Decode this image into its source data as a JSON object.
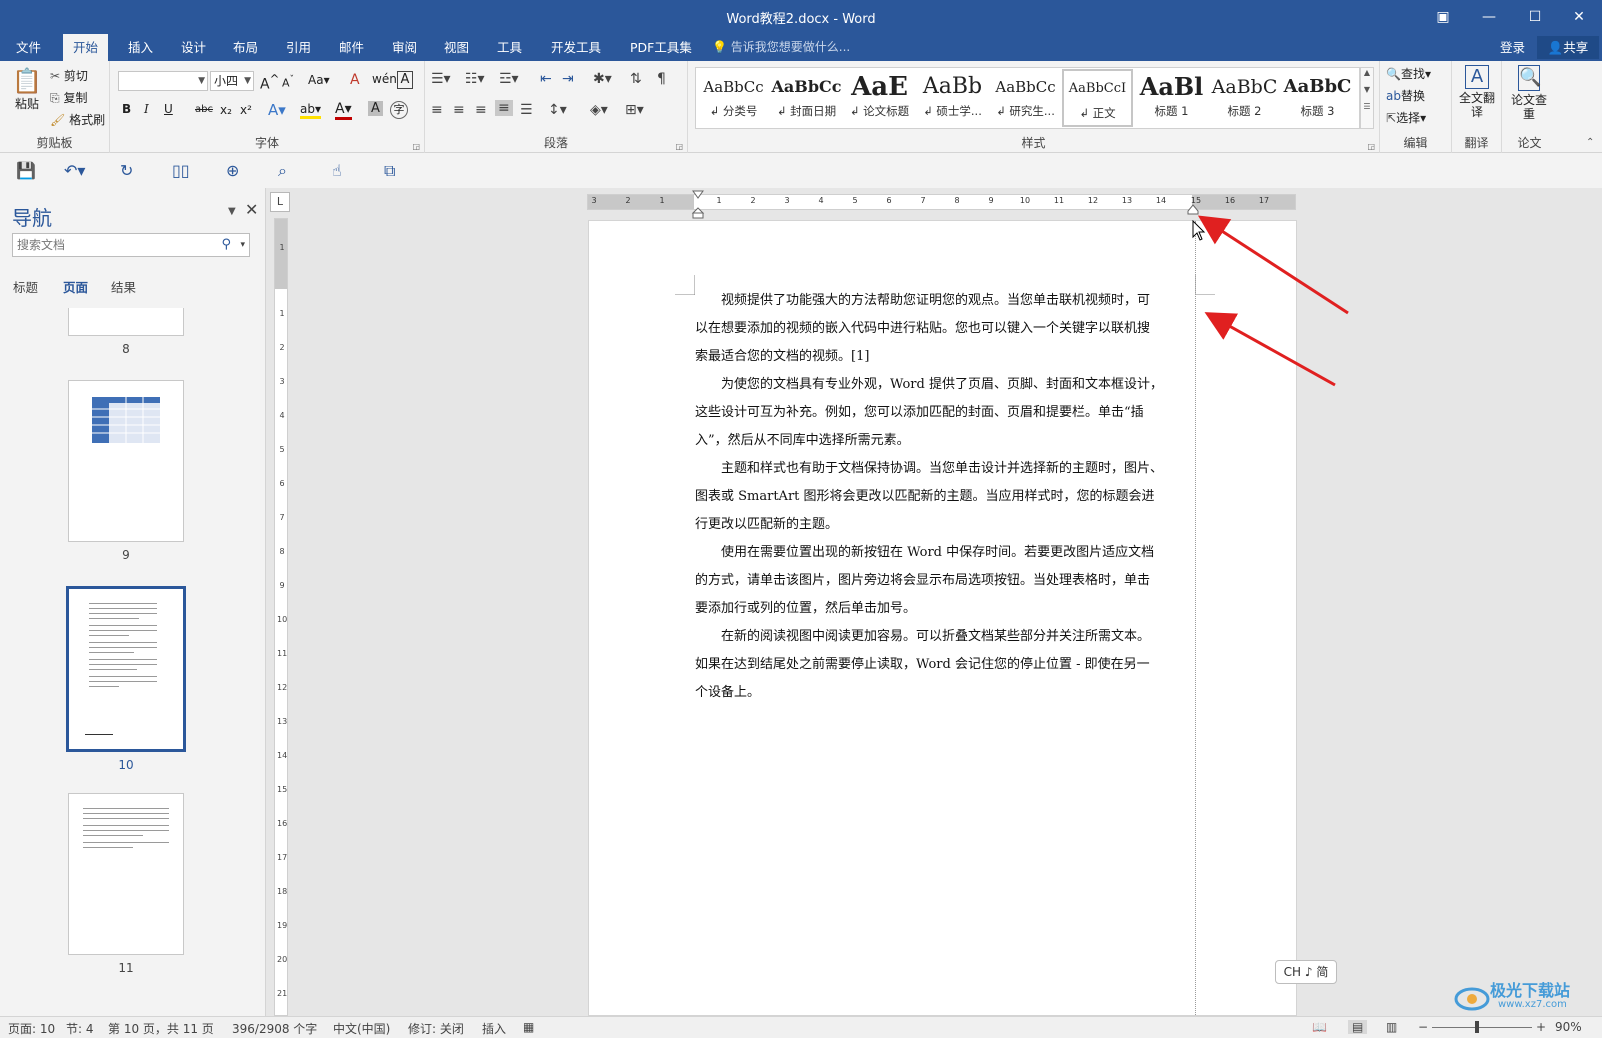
{
  "window": {
    "title": "Word教程2.docx - Word",
    "restore_icon": "ribbon-display-icon",
    "minimize": "—",
    "maximize": "☐",
    "close": "✕"
  },
  "tabs": [
    "文件",
    "开始",
    "插入",
    "设计",
    "布局",
    "引用",
    "邮件",
    "审阅",
    "视图",
    "工具",
    "开发工具",
    "PDF工具集"
  ],
  "active_tab": "开始",
  "tell_me": "告诉我您想要做什么...",
  "account": {
    "login": "登录",
    "share": "共享"
  },
  "ribbon": {
    "clipboard": {
      "label": "剪贴板",
      "paste": "粘贴",
      "cut": "剪切",
      "copy": "复制",
      "format_painter": "格式刷"
    },
    "font": {
      "label": "字体",
      "font_name": "",
      "font_size": "小四",
      "change_case": "Aa",
      "bold": "B",
      "italic": "I",
      "underline": "U",
      "strikethrough": "abc",
      "subscript": "x₂",
      "superscript": "x²",
      "text_effects": "A",
      "highlight": "ab",
      "font_color": "A",
      "char_shading": "A",
      "phonetic": "wén",
      "char_border": "A",
      "grow": "A",
      "shrink": "A",
      "clear": "A",
      "enclose": "字"
    },
    "paragraph": {
      "label": "段落"
    },
    "styles": {
      "label": "样式",
      "items": [
        {
          "preview": "AaBbCc",
          "name": "↲ 分类号"
        },
        {
          "preview": "AaBbCc",
          "name": "↲ 封面日期"
        },
        {
          "preview": "AaE",
          "name": "↲ 论文标题"
        },
        {
          "preview": "AaBb",
          "name": "↲ 硕士学..."
        },
        {
          "preview": "AaBbCc",
          "name": "↲ 研究生..."
        },
        {
          "preview": "AaBbCcI",
          "name": "↲ 正文"
        },
        {
          "preview": "AaBl",
          "name": "标题 1"
        },
        {
          "preview": "AaBbC",
          "name": "标题 2"
        },
        {
          "preview": "AaBbC",
          "name": "标题 3"
        }
      ],
      "selected_index": 5
    },
    "editing": {
      "label": "编辑",
      "find": "查找",
      "replace": "替换",
      "select": "选择"
    },
    "translate": {
      "label": "翻译",
      "full_translate": "全文翻译"
    },
    "paper": {
      "label": "论文",
      "check": "论文查重"
    }
  },
  "nav": {
    "title": "导航",
    "search_placeholder": "搜索文档",
    "tabs": [
      "标题",
      "页面",
      "结果"
    ],
    "active_tab": "页面",
    "pages": [
      "8",
      "9",
      "10",
      "11"
    ],
    "selected_page": "10"
  },
  "ruler": {
    "h_ticks": [
      "3",
      "2",
      "1",
      "1",
      "2",
      "3",
      "4",
      "5",
      "6",
      "7",
      "8",
      "9",
      "10",
      "11",
      "12",
      "13",
      "14",
      "15",
      "16",
      "17"
    ],
    "v_ticks": [
      "1",
      "1",
      "2",
      "3",
      "4",
      "5",
      "6",
      "7",
      "8",
      "9",
      "10",
      "11",
      "12",
      "13",
      "14",
      "15",
      "16",
      "17",
      "18",
      "19",
      "20",
      "21"
    ],
    "tab_selector": "L"
  },
  "document": {
    "paragraphs": [
      [
        "　　视频提供了功能强大的方法帮助您证明您的观点。当您单击联机视频时，可",
        "以在想要添加的视频的嵌入代码中进行粘贴。您也可以键入一个关键字以联机搜",
        "索最适合您的文档的视频。[1]"
      ],
      [
        "　　为使您的文档具有专业外观，Word 提供了页眉、页脚、封面和文本框设计，",
        "这些设计可互为补充。例如，您可以添加匹配的封面、页眉和提要栏。单击“插",
        "入”，然后从不同库中选择所需元素。"
      ],
      [
        "　　主题和样式也有助于文档保持协调。当您单击设计并选择新的主题时，图片、",
        "图表或 SmartArt 图形将会更改以匹配新的主题。当应用样式时，您的标题会进",
        "行更改以匹配新的主题。"
      ],
      [
        "　　使用在需要位置出现的新按钮在 Word 中保存时间。若要更改图片适应文档",
        "的方式，请单击该图片，图片旁边将会显示布局选项按钮。当处理表格时，单击",
        "要添加行或列的位置，然后单击加号。"
      ],
      [
        "　　在新的阅读视图中阅读更加容易。可以折叠文档某些部分并关注所需文本。",
        "如果在达到结尾处之前需要停止读取，Word 会记住您的停止位置 - 即使在另一",
        "个设备上。"
      ]
    ]
  },
  "ime": "CH ♪ 简",
  "status": {
    "page": "页面: 10",
    "section": "节: 4",
    "page_of": "第 10 页，共 11 页",
    "words": "396/2908 个字",
    "language": "中文(中国)",
    "track_changes": "修订: 关闭",
    "insert_mode": "插入",
    "zoom": "90%"
  },
  "watermark": {
    "text": "极光下载站",
    "url": "www.xz7.com"
  },
  "colors": {
    "accent": "#2b579a",
    "arrow": "#e02020"
  }
}
